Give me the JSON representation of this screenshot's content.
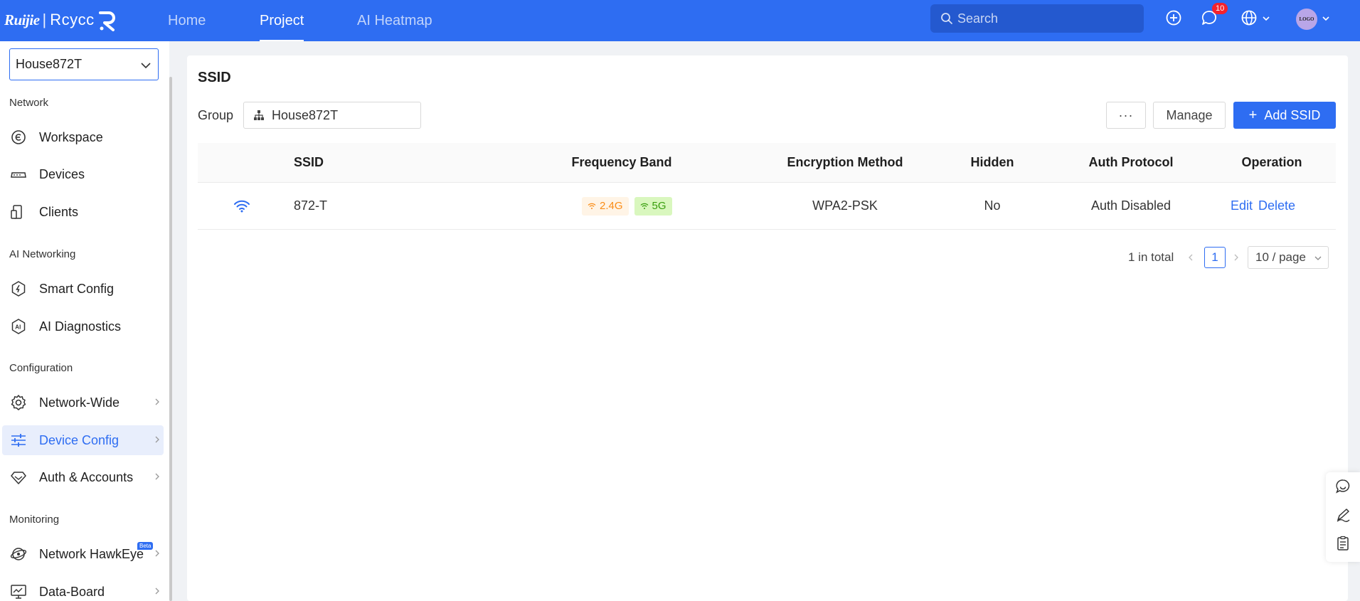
{
  "header": {
    "brand_primary": "Ruijie",
    "brand_separator": "|",
    "brand_secondary": "Rcycc",
    "nav": [
      {
        "label": "Home",
        "active": false
      },
      {
        "label": "Project",
        "active": true
      },
      {
        "label": "AI Heatmap",
        "active": false
      }
    ],
    "search_placeholder": "Search",
    "notification_count": "10",
    "avatar_text": "LOGO",
    "accent_color": "#2e6df2"
  },
  "sidebar": {
    "project_select": "House872T",
    "sections": [
      {
        "title": "Network",
        "items": [
          {
            "label": "Workspace",
            "icon": "workspace-icon"
          },
          {
            "label": "Devices",
            "icon": "devices-icon"
          },
          {
            "label": "Clients",
            "icon": "clients-icon"
          }
        ]
      },
      {
        "title": "AI Networking",
        "items": [
          {
            "label": "Smart Config",
            "icon": "smart-config-icon"
          },
          {
            "label": "AI Diagnostics",
            "icon": "ai-diagnostics-icon"
          }
        ]
      },
      {
        "title": "Configuration",
        "items": [
          {
            "label": "Network-Wide",
            "icon": "gear-icon",
            "has_submenu": true
          },
          {
            "label": "Device Config",
            "icon": "sliders-icon",
            "has_submenu": true,
            "active": true
          },
          {
            "label": "Auth & Accounts",
            "icon": "diamond-icon",
            "has_submenu": true
          }
        ]
      },
      {
        "title": "Monitoring",
        "items": [
          {
            "label": "Network HawkEye",
            "icon": "hawkeye-icon",
            "has_submenu": true,
            "badge": "Beta"
          },
          {
            "label": "Data-Board",
            "icon": "dashboard-icon",
            "has_submenu": true
          }
        ]
      }
    ]
  },
  "main": {
    "title": "SSID",
    "group_label": "Group",
    "group_value": "House872T",
    "more_button": "···",
    "manage_button": "Manage",
    "add_button": "Add SSID",
    "table": {
      "columns": [
        "SSID",
        "Frequency Band",
        "Encryption Method",
        "Hidden",
        "Auth Protocol",
        "Operation"
      ],
      "rows": [
        {
          "ssid": "872-T",
          "bands": [
            "2.4G",
            "5G"
          ],
          "encryption": "WPA2-PSK",
          "hidden": "No",
          "auth_protocol": "Auth Disabled",
          "actions": [
            "Edit",
            "Delete"
          ]
        }
      ]
    },
    "pagination": {
      "total_text": "1 in total",
      "current_page": "1",
      "page_size": "10 / page"
    }
  }
}
